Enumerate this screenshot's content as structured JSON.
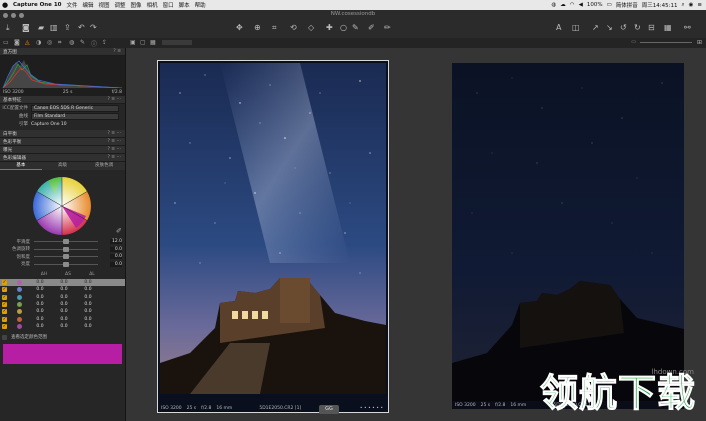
{
  "menubar": {
    "apple": "",
    "app_name": "Capture One 10",
    "menus": [
      "文件",
      "编辑",
      "视图",
      "调整",
      "图像",
      "相机",
      "窗口",
      "脚本",
      "帮助"
    ],
    "status": {
      "battery": "100%",
      "input_source": "简体拼音",
      "clock": "周三14:45:11"
    }
  },
  "window": {
    "title": "NW.cosessiondb"
  },
  "left_panel": {
    "histogram": {
      "header": "直方图",
      "iso": "ISO 3200",
      "shutter": "25 s",
      "aperture": "f/2.8"
    },
    "basic": {
      "header": "基本特征",
      "icc_label": "ICC配置文件",
      "icc_value": "Canon EOS 5DS R Generic",
      "curve_label": "曲线",
      "curve_value": "Film Standard",
      "engine_label": "引擎",
      "engine_value": "Capture One 10"
    },
    "sections": [
      "白平衡",
      "色彩平衡",
      "曝光",
      "色彩编辑器"
    ],
    "color_editor": {
      "tabs": [
        "基本",
        "高级",
        "皮肤色调"
      ],
      "sliders": [
        {
          "label": "平滑度",
          "value": "12.0",
          "pos": 0.5
        },
        {
          "label": "色调旋转",
          "value": "0.0",
          "pos": 0.5
        },
        {
          "label": "饱和度",
          "value": "0.0",
          "pos": 0.5
        },
        {
          "label": "亮度",
          "value": "0.0",
          "pos": 0.5
        }
      ],
      "columns": [
        "ΔH",
        "ΔS",
        "ΔL"
      ],
      "rows": [
        {
          "color": "#b060b0",
          "h": "0.0",
          "s": "0.0",
          "l": "0.0"
        },
        {
          "color": "#6a7ec9",
          "h": "0.0",
          "s": "0.0",
          "l": "0.0"
        },
        {
          "color": "#4f9ab0",
          "h": "0.0",
          "s": "0.0",
          "l": "0.0"
        },
        {
          "color": "#7aa04c",
          "h": "0.0",
          "s": "0.0",
          "l": "0.0"
        },
        {
          "color": "#b8a040",
          "h": "0.0",
          "s": "0.0",
          "l": "0.0"
        },
        {
          "color": "#c06040",
          "h": "0.0",
          "s": "0.0",
          "l": "0.0"
        },
        {
          "color": "#a04aa0",
          "h": "0.0",
          "s": "0.0",
          "l": "0.0"
        }
      ],
      "checkbox_label": "查看选定颜色范围",
      "swatch_color": "#b61fa3"
    }
  },
  "viewer": {
    "left_caption": {
      "iso": "ISO 3200",
      "shutter": "25 s",
      "aperture": "f/2.8",
      "focal": "16 mm",
      "filename": "5D1E2050.CR2 [1]",
      "dots": "• • • • • •"
    },
    "right_caption": {
      "iso": "ISO 3200",
      "shutter": "25 s",
      "aperture": "f/2.8",
      "focal": "16 mm",
      "filename": "5D1E2050.CR2 [1]"
    },
    "gg_tab": "GG"
  },
  "watermark": {
    "text": "领航下载",
    "url": "lhdown.com"
  }
}
